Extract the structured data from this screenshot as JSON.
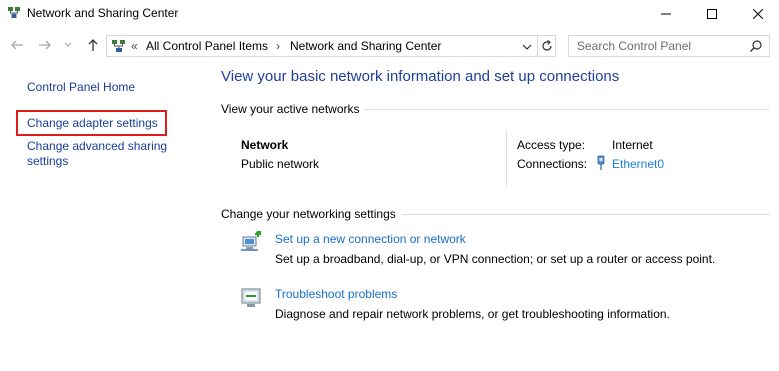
{
  "window": {
    "title": "Network and Sharing Center",
    "minimize_icon": "minimize-icon",
    "maximize_icon": "maximize-icon",
    "close_icon": "close-icon"
  },
  "nav": {
    "back_icon": "back-arrow-icon",
    "forward_icon": "forward-arrow-icon",
    "recent_icon": "chevron-down-icon",
    "up_icon": "up-arrow-icon",
    "breadcrumb_overflow": "«",
    "breadcrumbs": [
      "All Control Panel Items",
      "Network and Sharing Center"
    ],
    "crumb_separator": "›",
    "search_placeholder": "Search Control Panel"
  },
  "sidebar": {
    "items": [
      {
        "label": "Control Panel Home"
      },
      {
        "label": "Change adapter settings",
        "highlighted": true
      },
      {
        "label": "Change advanced sharing",
        "label_line2": "settings"
      }
    ]
  },
  "main": {
    "title": "View your basic network information and set up connections",
    "active_heading": "View your active networks",
    "network": {
      "name": "Network",
      "category": "Public network",
      "access_label": "Access type:",
      "access_value": "Internet",
      "connections_label": "Connections:",
      "connections_value": "Ethernet0"
    },
    "settings_heading": "Change your networking settings",
    "tasks": [
      {
        "icon": "new-connection-icon",
        "link": "Set up a new connection or network",
        "description": "Set up a broadband, dial-up, or VPN connection; or set up a router or access point."
      },
      {
        "icon": "troubleshoot-icon",
        "link": "Troubleshoot problems",
        "description": "Diagnose and repair network problems, or get troubleshooting information."
      }
    ]
  },
  "colors": {
    "link": "#1a3e9c",
    "title": "#1e3f9a",
    "highlight": "#e01b1b",
    "ethernet_link": "#1a7fd4"
  }
}
